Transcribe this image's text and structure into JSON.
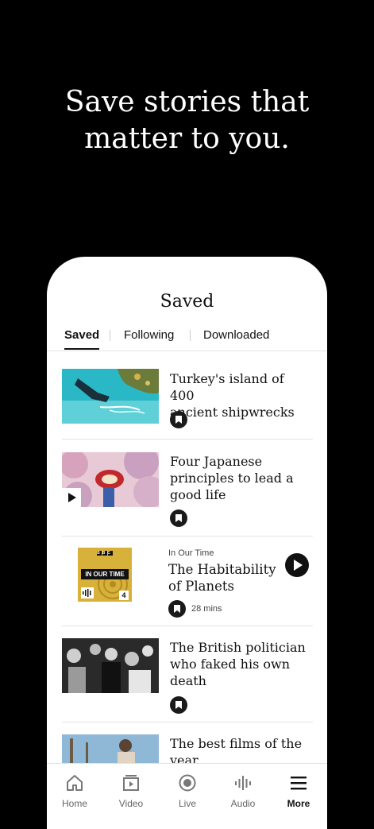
{
  "headline": {
    "line1": "Save stories that",
    "line2": "matter to you."
  },
  "screen": {
    "title": "Saved",
    "tabs": [
      {
        "label": "Saved",
        "active": true
      },
      {
        "label": "Following",
        "active": false
      },
      {
        "label": "Downloaded",
        "active": false
      }
    ],
    "items": [
      {
        "type": "article",
        "title_line1": "Turkey's island of 400",
        "title_line2": "ancient shipwrecks",
        "thumb": "diver-underwater"
      },
      {
        "type": "video",
        "title_line1": "Four Japanese",
        "title_line2": "principles to lead a",
        "title_line3": "good life",
        "thumb": "umbrella-cherry-blossoms"
      },
      {
        "type": "audio",
        "kicker": "In Our Time",
        "title_line1": "The Habitability",
        "title_line2": "of Planets",
        "duration": "28 mins",
        "thumb_brand": "BBC",
        "thumb_title": "IN OUR TIME",
        "thumb_channel": "4"
      },
      {
        "type": "article",
        "title_line1": "The British politician",
        "title_line2": "who faked his own",
        "title_line3": "death",
        "thumb": "crowd-photo-bw"
      },
      {
        "type": "article",
        "title_line1": "The best films of the",
        "title_line2": "year",
        "thumb": "film-still"
      }
    ],
    "nav": [
      {
        "label": "Home",
        "icon": "home-icon"
      },
      {
        "label": "Video",
        "icon": "video-icon"
      },
      {
        "label": "Live",
        "icon": "live-icon"
      },
      {
        "label": "Audio",
        "icon": "audio-icon"
      },
      {
        "label": "More",
        "icon": "more-icon",
        "active": true
      }
    ]
  }
}
